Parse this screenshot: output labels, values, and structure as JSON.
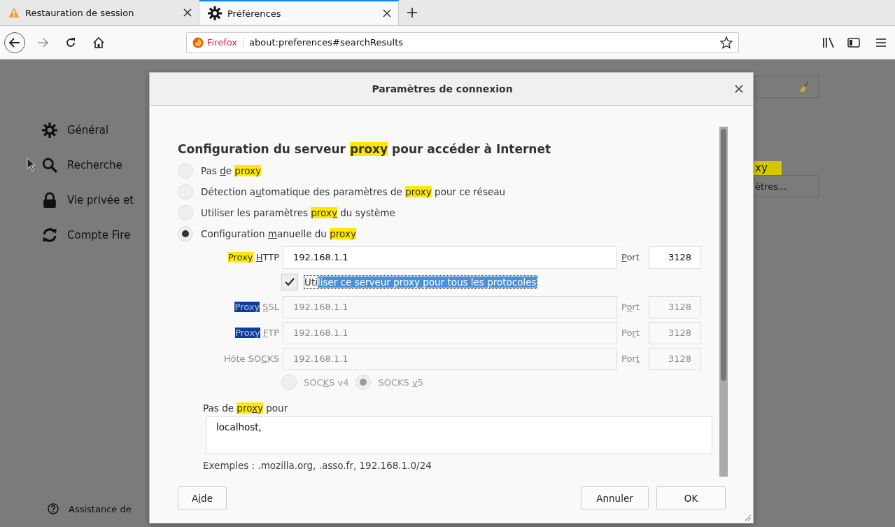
{
  "tabs": [
    {
      "title": "Restauration de session",
      "selected": false
    },
    {
      "title": "Préférences",
      "selected": true
    }
  ],
  "navbar": {
    "identity": "Firefox",
    "url": "about:preferences#searchResults"
  },
  "background": {
    "sidebar": [
      {
        "label": "Général"
      },
      {
        "label": "Recherche"
      },
      {
        "label": "Vie privée et"
      },
      {
        "label": "Compte Fire"
      }
    ],
    "support": "Assistance de",
    "match": "xy",
    "button": "ètres..."
  },
  "dialog": {
    "title": "Paramètres de connexion",
    "heading": [
      {
        "text": "Configuration du serveur ",
        "kind": "plain"
      },
      {
        "text": "proxy",
        "kind": "match"
      },
      {
        "text": " pour accéder à Internet",
        "kind": "plain"
      }
    ],
    "modes": [
      {
        "selected": false,
        "label": [
          {
            "text": "Pas ",
            "kind": "plain"
          },
          {
            "text": "d",
            "kind": "key"
          },
          {
            "text": "e ",
            "kind": "plain"
          },
          {
            "text": "proxy",
            "kind": "match"
          }
        ]
      },
      {
        "selected": false,
        "label": [
          {
            "text": "Détection a",
            "kind": "plain"
          },
          {
            "text": "u",
            "kind": "key"
          },
          {
            "text": "tomatique des paramètres de ",
            "kind": "plain"
          },
          {
            "text": "proxy",
            "kind": "match"
          },
          {
            "text": " pour ce réseau",
            "kind": "plain"
          }
        ]
      },
      {
        "selected": false,
        "label": [
          {
            "text": "Utiliser les paramètres ",
            "kind": "plain"
          },
          {
            "text": "prox",
            "kind": "match"
          },
          {
            "text": "y",
            "kind": "match-key"
          },
          {
            "text": " du système",
            "kind": "plain"
          }
        ]
      },
      {
        "selected": true,
        "label": [
          {
            "text": "Configuration ",
            "kind": "plain"
          },
          {
            "text": "m",
            "kind": "key"
          },
          {
            "text": "anuelle du ",
            "kind": "plain"
          },
          {
            "text": "proxy",
            "kind": "match"
          }
        ]
      }
    ],
    "http": {
      "disabled": false,
      "label": [
        [
          {
            "text": "Proxy",
            "kind": "match"
          }
        ],
        [
          {
            "text": "H",
            "kind": "key"
          },
          {
            "text": "TTP",
            "kind": "plain"
          }
        ]
      ],
      "value": "192.168.1.1",
      "port_label": [
        {
          "text": "P",
          "kind": "key"
        },
        {
          "text": "ort",
          "kind": "plain"
        }
      ],
      "port": "3128"
    },
    "share": {
      "checked": true,
      "label": [
        {
          "text": "Uti",
          "kind": "plain"
        },
        {
          "text": "liser ce serveur proxy pour tous les protocoles",
          "kind": "selection"
        }
      ]
    },
    "others": [
      {
        "disabled": true,
        "label": [
          [
            {
              "text": "Proxy",
              "kind": "selection-dark"
            }
          ],
          [
            {
              "text": "S",
              "kind": "key"
            },
            {
              "text": "SL",
              "kind": "plain"
            }
          ]
        ],
        "value": "192.168.1.1",
        "port_label": [
          {
            "text": "P",
            "kind": "plain"
          },
          {
            "text": "o",
            "kind": "key"
          },
          {
            "text": "rt",
            "kind": "plain"
          }
        ],
        "port": "3128"
      },
      {
        "disabled": true,
        "label": [
          [
            {
              "text": "Proxy",
              "kind": "selection-dark"
            }
          ],
          [
            {
              "text": "F",
              "kind": "key"
            },
            {
              "text": "TP",
              "kind": "plain"
            }
          ]
        ],
        "value": "192.168.1.1",
        "port_label": [
          {
            "text": "Po",
            "kind": "plain"
          },
          {
            "text": "r",
            "kind": "key"
          },
          {
            "text": "t",
            "kind": "plain"
          }
        ],
        "port": "3128"
      },
      {
        "disabled": true,
        "label": [
          {
            "text": "Hôte SO",
            "kind": "plain"
          },
          {
            "text": "C",
            "kind": "key"
          },
          {
            "text": "KS",
            "kind": "plain"
          }
        ],
        "value": "192.168.1.1",
        "port_label": [
          {
            "text": "Por",
            "kind": "plain"
          },
          {
            "text": "t",
            "kind": "key"
          }
        ],
        "port": "3128"
      }
    ],
    "socks": [
      {
        "selected": false,
        "label": [
          {
            "text": "SOC",
            "kind": "plain"
          },
          {
            "text": "K",
            "kind": "key"
          },
          {
            "text": "S v4",
            "kind": "plain"
          }
        ]
      },
      {
        "selected": true,
        "label": [
          {
            "text": "SOCKS ",
            "kind": "plain"
          },
          {
            "text": "v",
            "kind": "key"
          },
          {
            "text": "5",
            "kind": "plain"
          }
        ]
      }
    ],
    "socks_disabled": true,
    "no_proxy_label": [
      {
        "text": "Pas de ",
        "kind": "plain"
      },
      {
        "text": "pro",
        "kind": "match"
      },
      {
        "text": "x",
        "kind": "match-key"
      },
      {
        "text": "y",
        "kind": "match"
      },
      {
        "text": " pour",
        "kind": "plain"
      }
    ],
    "no_proxy_value": "localhost,",
    "examples": "Exemples : .mozilla.org, .asso.fr, 192.168.1.0/24",
    "buttons": [
      {
        "label": [
          {
            "text": "A",
            "kind": "plain"
          },
          {
            "text": "i",
            "kind": "key"
          },
          {
            "text": "de",
            "kind": "plain"
          }
        ]
      },
      {
        "label": [
          {
            "text": "Annuler",
            "kind": "plain"
          }
        ]
      },
      {
        "label": [
          {
            "text": "OK",
            "kind": "plain"
          }
        ]
      }
    ]
  }
}
